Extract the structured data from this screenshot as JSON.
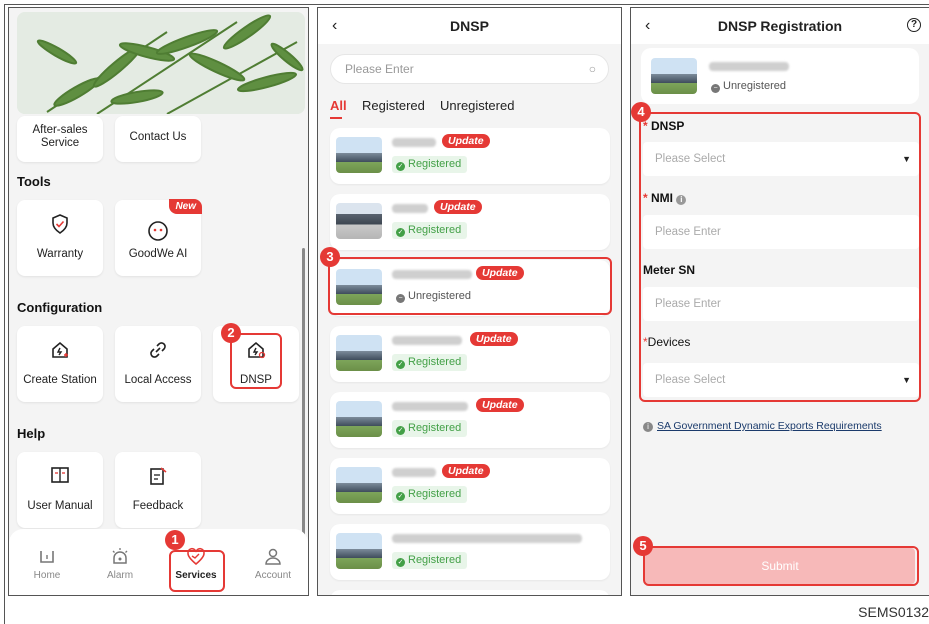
{
  "figure_code": "SEMS0132",
  "panel1": {
    "partial_tiles": {
      "after_sales": "After-sales\nService",
      "contact": "Contact Us"
    },
    "sections": {
      "tools": "Tools",
      "configuration": "Configuration",
      "help": "Help"
    },
    "tiles": {
      "warranty": "Warranty",
      "goodwe_ai": "GoodWe AI",
      "new_badge": "New",
      "create_station": "Create Station",
      "local_access": "Local Access",
      "dnsp": "DNSP",
      "user_manual": "User Manual",
      "feedback": "Feedback"
    },
    "tabs": {
      "home": "Home",
      "alarm": "Alarm",
      "services": "Services",
      "account": "Account"
    },
    "steps": {
      "one": "1",
      "two": "2"
    }
  },
  "panel2": {
    "title": "DNSP",
    "search_placeholder": "Please Enter",
    "filters": {
      "all": "All",
      "registered": "Registered",
      "unregistered": "Unregistered"
    },
    "update_label": "Update",
    "stations": [
      {
        "status": "Registered",
        "update": true
      },
      {
        "status": "Registered",
        "update": true
      },
      {
        "status": "Unregistered",
        "update": true
      },
      {
        "status": "Registered",
        "update": true
      },
      {
        "status": "Registered",
        "update": true
      },
      {
        "status": "Registered",
        "update": true
      },
      {
        "status": "Registered",
        "update": false
      }
    ],
    "step": "3"
  },
  "panel3": {
    "title": "DNSP Registration",
    "help_glyph": "?",
    "station_status": "Unregistered",
    "fields": {
      "dnsp_label": "DNSP",
      "dnsp_placeholder": "Please Select",
      "nmi_label": "NMI",
      "nmi_placeholder": "Please Enter",
      "meter_label": "Meter SN",
      "meter_placeholder": "Please Enter",
      "devices_label": "Devices",
      "devices_placeholder": "Please Select"
    },
    "link": "SA Government Dynamic Exports Requirements",
    "submit": "Submit",
    "steps": {
      "four": "4",
      "five": "5"
    }
  },
  "colors": {
    "accent": "#e53935",
    "registered": "#43a047",
    "submit_disabled": "#f7b9b9"
  }
}
